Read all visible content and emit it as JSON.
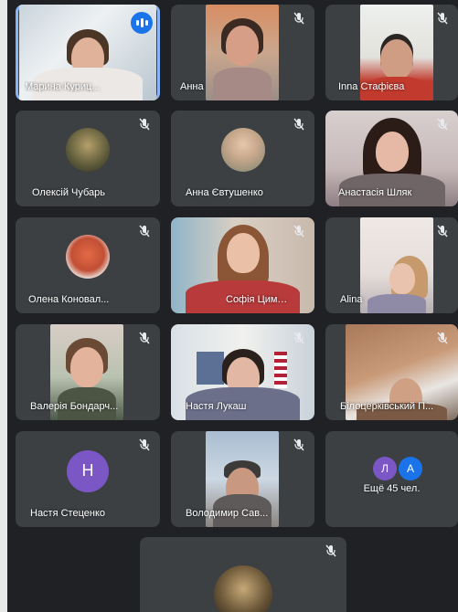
{
  "participants": [
    {
      "name": "Марина Куриц...",
      "speaking": true
    },
    {
      "name": "Анна"
    },
    {
      "name": "Inna Стафієва"
    },
    {
      "name": "Олексій Чубарь"
    },
    {
      "name": "Анна Євтушенко"
    },
    {
      "name": "Анастасія Шляк"
    },
    {
      "name": "Олена Коновал..."
    },
    {
      "name": "Софія Цимбалюк"
    },
    {
      "name": "Alina"
    },
    {
      "name": "Валерія Бондарч..."
    },
    {
      "name": "Настя Лукаш"
    },
    {
      "name": "Білоцерківський П..."
    },
    {
      "name": "Настя Стеценко",
      "initial": "Н"
    },
    {
      "name": "Володимир Сав..."
    },
    {
      "name": ""
    }
  ],
  "overflow": {
    "label": "Ещё 45 чел.",
    "avatars": [
      "Л",
      "А"
    ]
  },
  "colors": {
    "tile_bg": "#3c4043",
    "page_bg": "#202124",
    "active_border": "#8ab4f8",
    "avatar_purple": "#7b57c6"
  }
}
